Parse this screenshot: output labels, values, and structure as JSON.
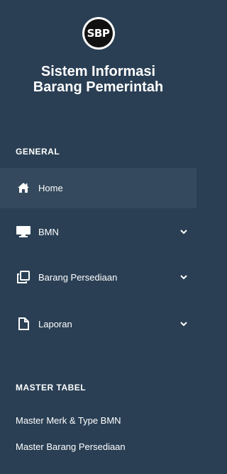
{
  "logo": {
    "text": "SBP"
  },
  "app_title": {
    "line1": "Sistem Informasi",
    "line2": "Barang Pemerintah"
  },
  "sections": {
    "general": "GENERAL",
    "master": "MASTER TABEL"
  },
  "nav": {
    "home": {
      "label": "Home",
      "icon": "home-icon"
    },
    "bmn": {
      "label": "BMN",
      "icon": "monitor-icon"
    },
    "persediaan": {
      "label": "Barang Persediaan",
      "icon": "copy-icon"
    },
    "laporan": {
      "label": "Laporan",
      "icon": "file-icon"
    }
  },
  "master_links": {
    "merk": "Master Merk & Type BMN",
    "barang": "Master Barang Persediaan"
  },
  "colors": {
    "sidebar_bg": "#2a3f54",
    "active_bg": "#34495d",
    "text": "#ffffff"
  }
}
